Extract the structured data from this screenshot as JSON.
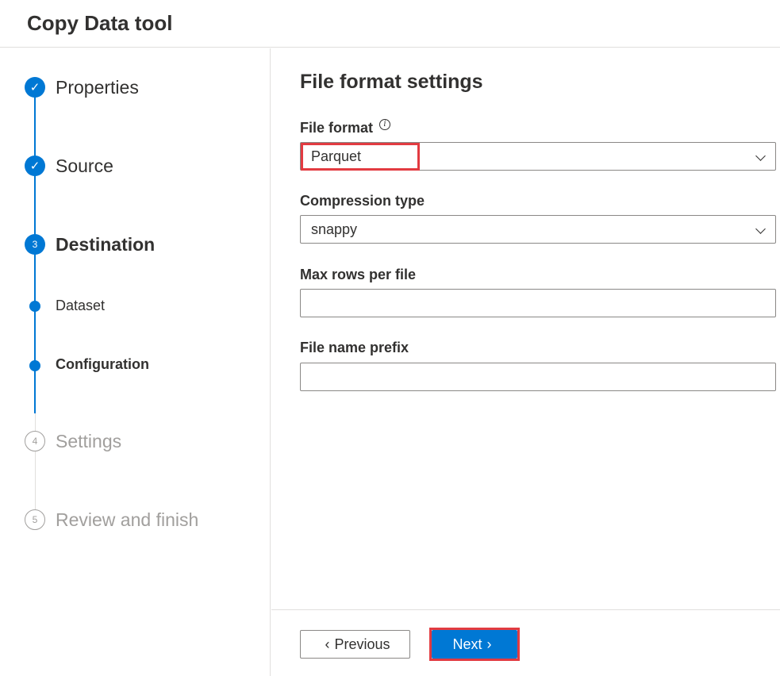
{
  "header": {
    "title": "Copy Data tool"
  },
  "stepper": {
    "steps": [
      {
        "label": "Properties",
        "state": "done",
        "marker": "✓"
      },
      {
        "label": "Source",
        "state": "done",
        "marker": "✓"
      },
      {
        "label": "Destination",
        "state": "current",
        "marker": "3"
      },
      {
        "label": "Settings",
        "state": "pending",
        "marker": "4"
      },
      {
        "label": "Review and finish",
        "state": "pending",
        "marker": "5"
      }
    ],
    "substeps": [
      {
        "label": "Dataset",
        "active": false
      },
      {
        "label": "Configuration",
        "active": true
      }
    ]
  },
  "main": {
    "section_title": "File format settings",
    "file_format": {
      "label": "File format",
      "value": "Parquet",
      "info_icon": "i"
    },
    "compression": {
      "label": "Compression type",
      "value": "snappy"
    },
    "max_rows": {
      "label": "Max rows per file",
      "value": ""
    },
    "prefix": {
      "label": "File name prefix",
      "value": ""
    }
  },
  "footer": {
    "previous_label": "Previous",
    "previous_icon": "‹",
    "next_label": "Next",
    "next_icon": "›"
  },
  "colors": {
    "accent": "#0078d4",
    "highlight": "#e23b41",
    "pending": "#a19f9d"
  }
}
